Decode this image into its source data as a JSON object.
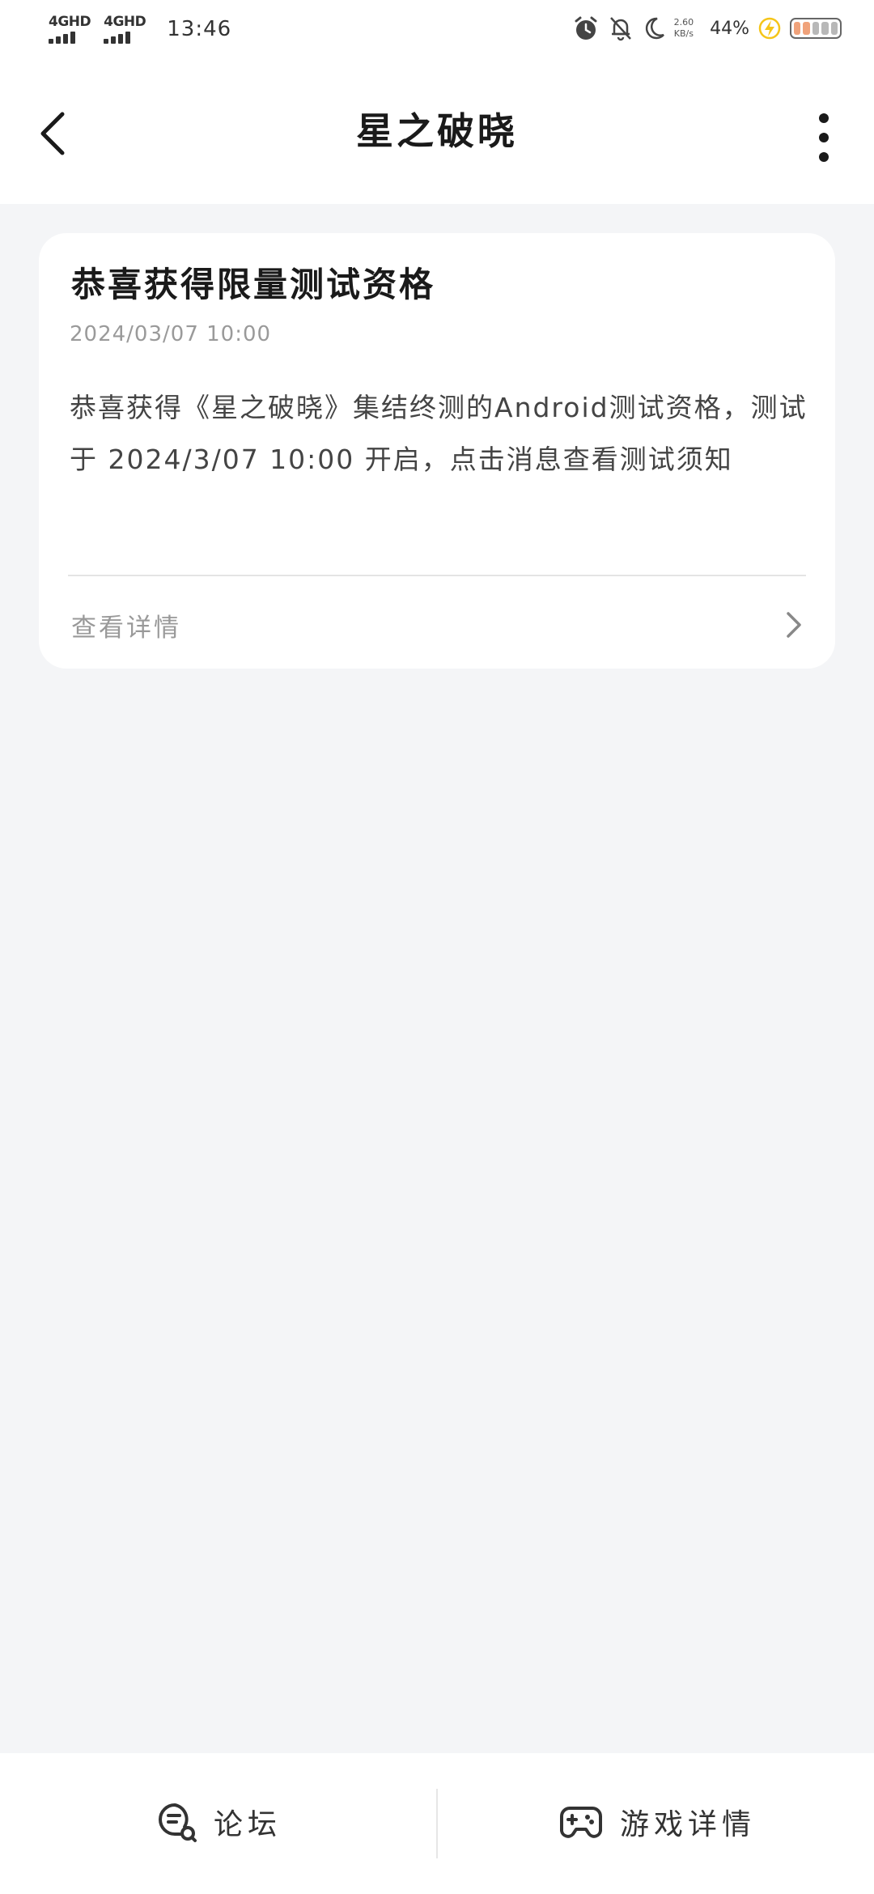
{
  "status_bar": {
    "signal1_label": "4GHD",
    "signal2_label": "4GHD",
    "time": "13:46",
    "speed_value": "2.60",
    "speed_unit": "KB/s",
    "battery_percent": "44%",
    "icons": [
      "alarm-icon",
      "bell-off-icon",
      "moon-icon",
      "charging-icon",
      "battery-icon"
    ]
  },
  "header": {
    "title": "星之破晓"
  },
  "message": {
    "title": "恭喜获得限量测试资格",
    "timestamp": "2024/03/07 10:00",
    "body": "恭喜获得《星之破晓》集结终测的Android测试资格，测试于 2024/3/07 10:00 开启，点击消息查看测试须知",
    "detail_label": "查看详情"
  },
  "bottom_nav": {
    "forum_label": "论坛",
    "game_detail_label": "游戏详情"
  },
  "colors": {
    "background": "#f4f5f7",
    "card": "#ffffff",
    "charging_accent": "#f5c518"
  }
}
